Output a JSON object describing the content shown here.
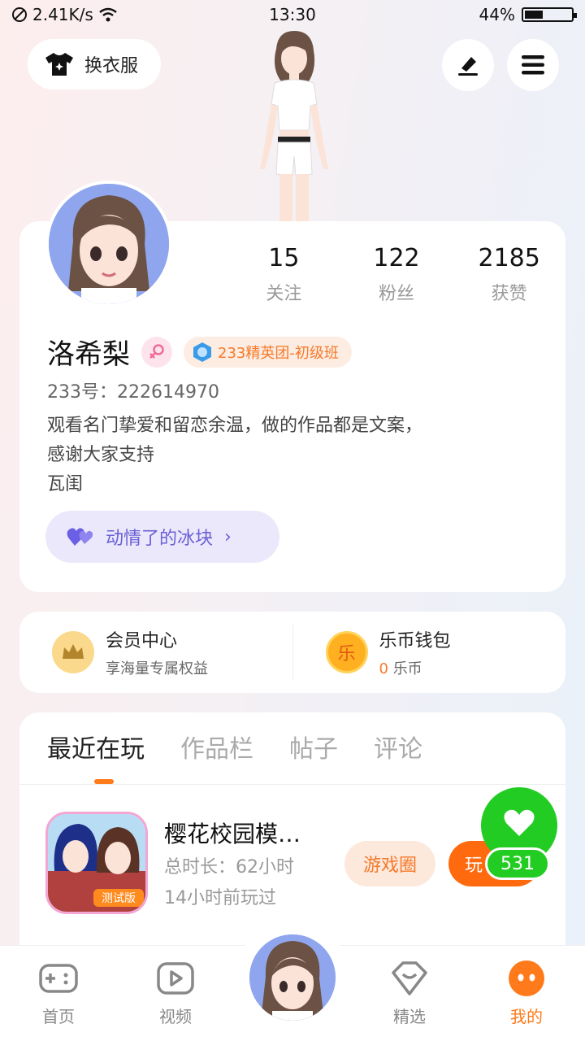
{
  "status_bar": {
    "speed": "2.41K/s",
    "time": "13:30",
    "battery_percent_text": "44%",
    "battery_level": 0.44
  },
  "top_actions": {
    "change_outfit_label": "换衣服"
  },
  "profile": {
    "stats": [
      {
        "value": "15",
        "label": "关注"
      },
      {
        "value": "122",
        "label": "粉丝"
      },
      {
        "value": "2185",
        "label": "获赞"
      }
    ],
    "name": "洛希梨",
    "level_badge": "233精英团-初级班",
    "uid": "233号：222614970",
    "bio_lines": [
      "观看名门挚爱和留恋余温，做的作品都是文案，",
      "感谢大家支持",
      "瓦闺"
    ],
    "mood_label": "动情了的冰块"
  },
  "wallet": {
    "member_title": "会员中心",
    "member_sub": "享海量专属权益",
    "coin_title": "乐币钱包",
    "coin_count": "0",
    "coin_unit": "乐币",
    "coin_glyph": "乐"
  },
  "tabs": [
    {
      "label": "最近在玩",
      "active": true
    },
    {
      "label": "作品栏",
      "active": false
    },
    {
      "label": "帖子",
      "active": false
    },
    {
      "label": "评论",
      "active": false
    }
  ],
  "recent_game": {
    "title": "樱花校园模…",
    "total_time": "总时长：62小时",
    "last_played": "14小时前玩过",
    "circle_button": "游戏圈",
    "play_button": "玩",
    "icon_label": "测试版"
  },
  "like_float": {
    "count": "531"
  },
  "bottom_nav": [
    {
      "label": "首页",
      "icon": "gamepad-icon",
      "active": false
    },
    {
      "label": "视频",
      "icon": "video-play-icon",
      "active": false
    },
    {
      "label": "精选",
      "icon": "heart-box-icon",
      "active": false
    },
    {
      "label": "我的",
      "icon": "profile-face-icon",
      "active": true
    }
  ],
  "colors": {
    "accent_orange": "#ff7a1a",
    "like_green": "#22cc22",
    "mood_purple": "#6a5fd6"
  }
}
